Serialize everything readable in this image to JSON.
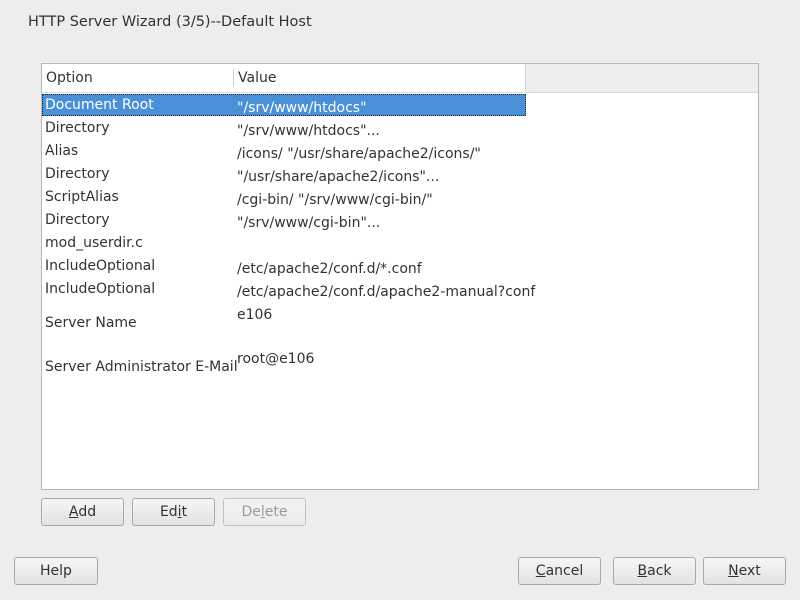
{
  "window": {
    "title": "HTTP Server Wizard (3/5)--Default Host"
  },
  "table": {
    "columns": {
      "option": "Option",
      "value": "Value"
    },
    "rows": [
      {
        "option": "Document Root",
        "value": "\"/srv/www/htdocs\"",
        "selected": true
      },
      {
        "option": "Directory",
        "value": "\"/srv/www/htdocs\"..."
      },
      {
        "option": "Alias",
        "value": "/icons/ \"/usr/share/apache2/icons/\""
      },
      {
        "option": "Directory",
        "value": "\"/usr/share/apache2/icons\"..."
      },
      {
        "option": "ScriptAlias",
        "value": "/cgi-bin/ \"/srv/www/cgi-bin/\""
      },
      {
        "option": "Directory",
        "value": "\"/srv/www/cgi-bin\"..."
      },
      {
        "option": "mod_userdir.c",
        "value": ""
      },
      {
        "option": "IncludeOptional",
        "value": "/etc/apache2/conf.d/*.conf"
      },
      {
        "option": "IncludeOptional",
        "value": "/etc/apache2/conf.d/apache2-manual?conf"
      },
      {
        "option": "Server Name",
        "value": "e106"
      },
      {
        "option": "Server Administrator E-Mail",
        "value": "root@e106"
      }
    ]
  },
  "buttons": {
    "add": {
      "label": "Add",
      "mnemonic": "A",
      "rest": "dd"
    },
    "edit": {
      "label": "Edit",
      "pre": "Ed",
      "mnemonic": "i",
      "rest": "t"
    },
    "delete": {
      "label": "Delete",
      "disabled": true,
      "pre": "De",
      "mnemonic": "l",
      "rest": "ete"
    },
    "help": {
      "label": "Help"
    },
    "cancel": {
      "label": "Cancel",
      "mnemonic": "C",
      "rest": "ancel"
    },
    "back": {
      "label": "Back",
      "mnemonic": "B",
      "rest": "ack"
    },
    "next": {
      "label": "Next",
      "mnemonic": "N",
      "rest": "ext"
    }
  }
}
